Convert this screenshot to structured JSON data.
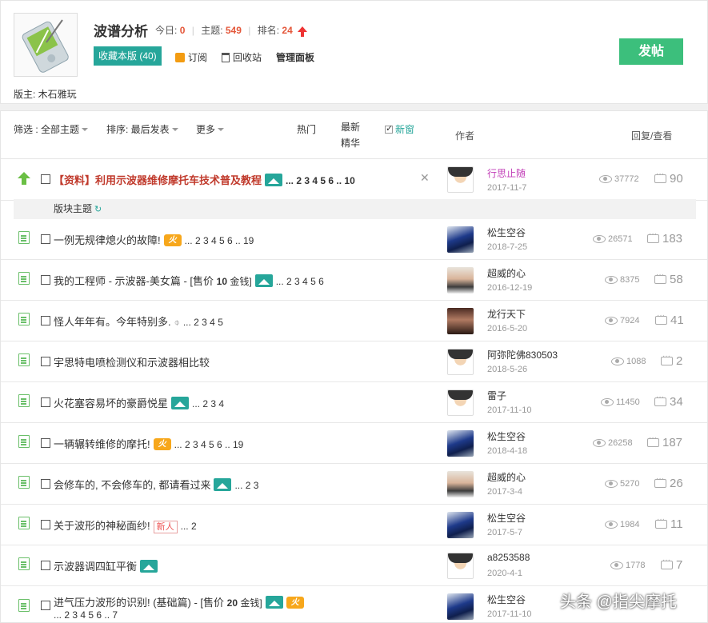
{
  "forum": {
    "title": "波谱分析",
    "today_label": "今日:",
    "today": "0",
    "topics_label": "主题:",
    "topics": "549",
    "rank_label": "排名:",
    "rank": "24",
    "fav_button": "收藏本版 (40)",
    "subscribe": "订阅",
    "recycle": "回收站",
    "admin": "管理面板",
    "post_button": "发帖",
    "moderator": "版主: 木石雅玩"
  },
  "filters": {
    "filter": "筛选 : 全部主题",
    "sort": "排序: 最后发表",
    "more": "更多",
    "hot": "热门",
    "newest": "最新",
    "digest": "精华",
    "new_window": "新窗",
    "author": "作者",
    "reply_view": "回复/查看"
  },
  "pinned": {
    "title": "【资料】利用示波器维修摩托车技术普及教程",
    "pages": "... 2 3 4 5 6 .. 10",
    "user": "行思止随",
    "date": "2017-11-7",
    "views": "37772",
    "replies": "90"
  },
  "section": {
    "label": "版块主题"
  },
  "threads": [
    {
      "title": "一例无规律熄火的故障!",
      "pages": "... 2 3 4 5 6 .. 19",
      "user": "松生空谷",
      "date": "2018-7-25",
      "views": "26571",
      "replies": "183"
    },
    {
      "title": "我的工程师 - 示波器-美女篇 - [售价 ",
      "price": "10",
      "price_tail": " 金钱]",
      "pages": "... 2 3 4 5 6",
      "user": "超威的心",
      "date": "2016-12-19",
      "views": "8375",
      "replies": "58"
    },
    {
      "title": "怪人年年有。今年特别多.",
      "pages": "... 2 3 4 5",
      "user": "龙行天下",
      "date": "2016-5-20",
      "views": "7924",
      "replies": "41"
    },
    {
      "title": "宇思特电喷检测仪和示波器相比较",
      "pages": "",
      "user": "阿弥陀佛830503",
      "date": "2018-5-26",
      "views": "1088",
      "replies": "2"
    },
    {
      "title": "火花塞容易坏的豪爵悦星",
      "pages": "... 2 3 4",
      "user": "雷子",
      "date": "2017-11-10",
      "views": "11450",
      "replies": "34"
    },
    {
      "title": "一辆辗转维修的摩托!",
      "pages": "... 2 3 4 5 6 .. 19",
      "user": "松生空谷",
      "date": "2018-4-18",
      "views": "26258",
      "replies": "187"
    },
    {
      "title": "会修车的, 不会修车的, 都请看过来",
      "pages": "... 2 3",
      "user": "超威的心",
      "date": "2017-3-4",
      "views": "5270",
      "replies": "26"
    },
    {
      "title": "关于波形的神秘面纱!",
      "badge": "新人",
      "pages": "... 2",
      "user": "松生空谷",
      "date": "2017-5-7",
      "views": "1984",
      "replies": "11"
    },
    {
      "title": "示波器调四缸平衡",
      "pages": "",
      "user": "a8253588",
      "date": "2020-4-1",
      "views": "1778",
      "replies": "7"
    },
    {
      "title": "进气压力波形的识别! (基础篇) - [售价 ",
      "price": "20",
      "price_tail": " 金钱]",
      "pages": "... 2 3 4 5 6 .. 7",
      "user": "松生空谷",
      "date": "2017-11-10",
      "views": "",
      "replies": ""
    }
  ],
  "hot_label": "火",
  "watermark": "头条 @指尖摩托"
}
